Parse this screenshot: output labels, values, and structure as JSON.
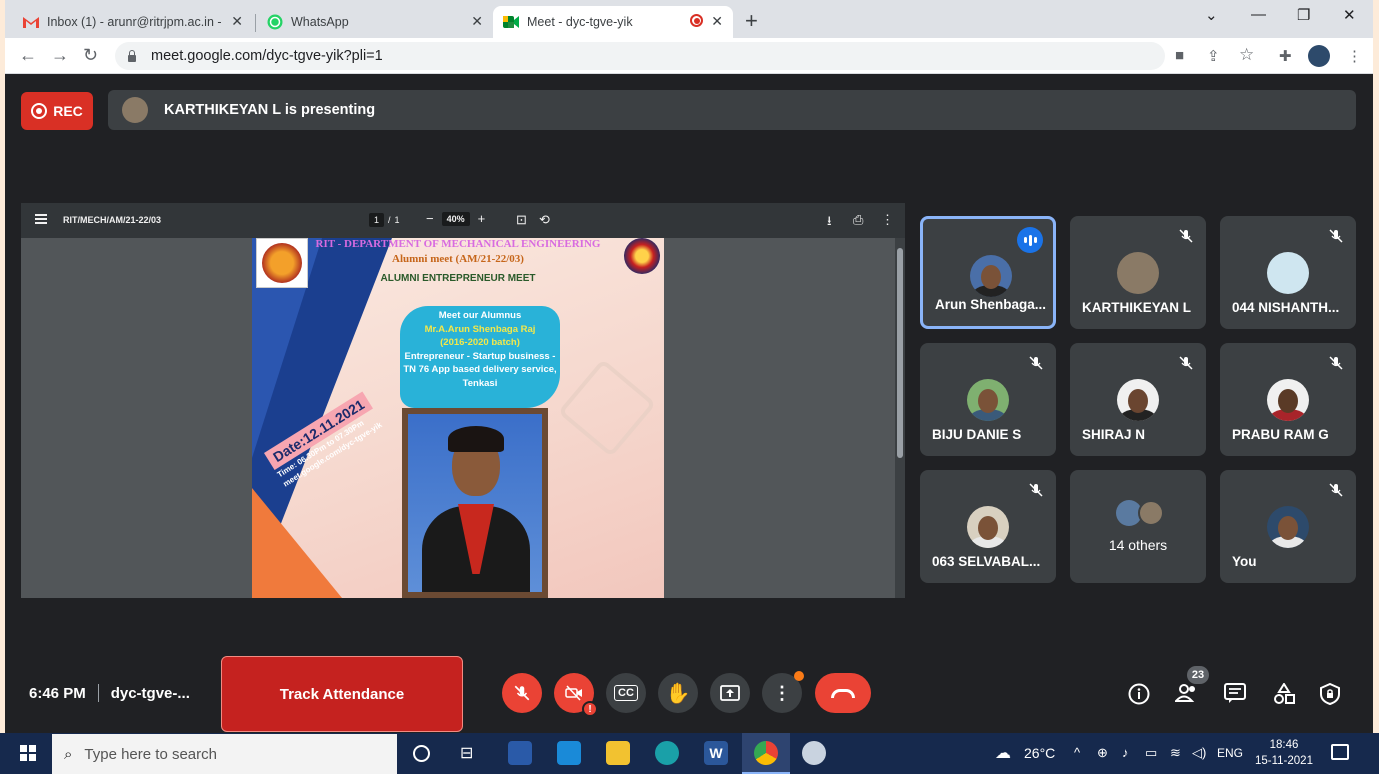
{
  "browser": {
    "tabs": [
      {
        "title": "Inbox (1) - arunr@ritrjpm.ac.in - ",
        "icon": "gmail-icon"
      },
      {
        "title": "WhatsApp",
        "icon": "whatsapp-icon"
      },
      {
        "title": "Meet - dyc-tgve-yik",
        "icon": "meet-icon",
        "active": true
      }
    ],
    "url": "meet.google.com/dyc-tgve-yik?pli=1"
  },
  "meet": {
    "rec_label": "REC",
    "presenting_text": "KARTHIKEYAN L is presenting",
    "pdf": {
      "title": "RIT/MECH/AM/21-22/03",
      "page_current": "1",
      "page_total": "1",
      "zoom": "40%",
      "poster": {
        "heading": "RIT - DEPARTMENT OF MECHANICAL ENGINEERING",
        "subheading": "Alumni meet (AM/21-22/03)",
        "event": "ALUMNI ENTREPRENEUR MEET",
        "cloud_line1": "Meet our Alumnus",
        "cloud_line2": "Mr.A.Arun Shenbaga Raj",
        "cloud_line3": "(2016-2020 batch)",
        "cloud_line4": "Entrepreneur - Startup business - TN 76 App based delivery service, Tenkasi",
        "date": "Date:12.11.2021",
        "time": "Time: 06.30Pm to 07.30Pm",
        "link": "meet.google.com/dyc-tgve-yik"
      }
    },
    "participants": [
      {
        "name": "Arun Shenbaga...",
        "speaking": true
      },
      {
        "name": "KARTHIKEYAN L",
        "muted": true
      },
      {
        "name": "044 NISHANTH...",
        "muted": true
      },
      {
        "name": "BIJU DANIE S",
        "muted": true
      },
      {
        "name": "SHIRAJ N",
        "muted": true
      },
      {
        "name": "PRABU RAM G",
        "muted": true
      },
      {
        "name": "063 SELVABAL...",
        "muted": true
      },
      {
        "name": "14 others"
      },
      {
        "name": "You",
        "muted": true
      }
    ],
    "bottom": {
      "time": "6:46 PM",
      "meeting_code": "dyc-tgve-...",
      "attendance_button": "Track Attendance",
      "people_count": "23"
    }
  },
  "taskbar": {
    "search_placeholder": "Type here to search",
    "weather": "26°C",
    "language": "ENG",
    "time": "18:46",
    "date": "15-11-2021"
  },
  "colors": {
    "meet_bg": "#202124",
    "tile_bg": "#3c4043",
    "rec_red": "#d93025",
    "attend_red": "#c5221f",
    "speaking_blue": "#8ab4f8",
    "taskbar": "#16294d"
  }
}
